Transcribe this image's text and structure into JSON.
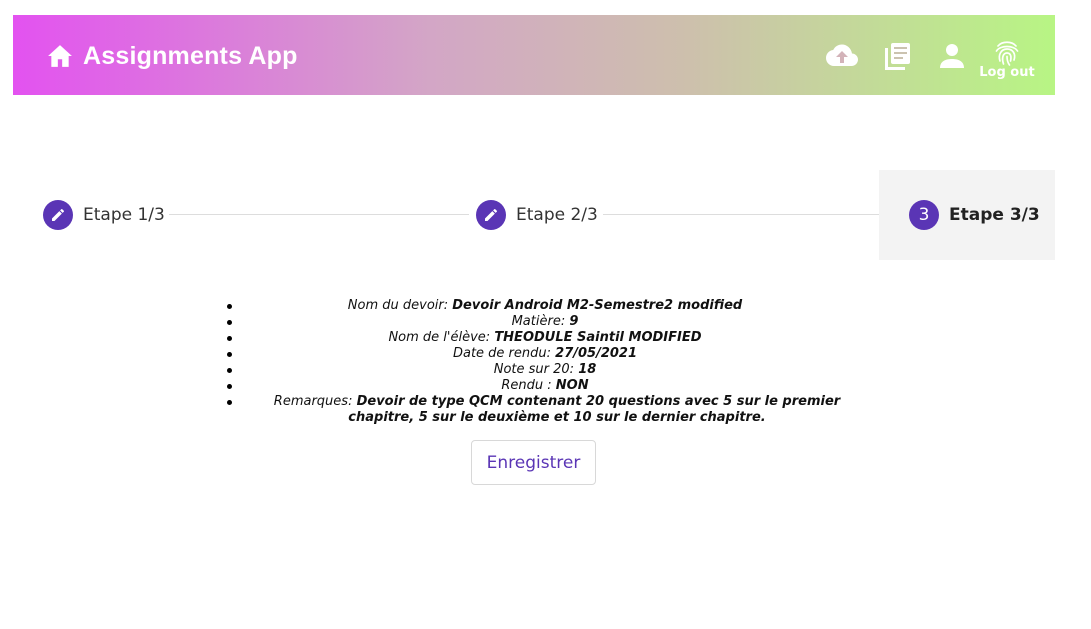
{
  "header": {
    "title": "Assignments App",
    "logout_label": "Log out",
    "icons": [
      "home-icon",
      "cloud-upload-icon",
      "library-books-icon",
      "person-icon",
      "fingerprint-icon"
    ],
    "gradient": [
      "#e352f0",
      "#b8f584"
    ]
  },
  "stepper": {
    "steps": [
      {
        "label": "Etape 1/3",
        "icon": "pencil-icon",
        "state": "done"
      },
      {
        "label": "Etape 2/3",
        "icon": "pencil-icon",
        "state": "done"
      },
      {
        "label": "Etape 3/3",
        "number": "3",
        "state": "active"
      }
    ],
    "accent": "#5a35b5"
  },
  "details": {
    "name_label": "Nom du devoir:",
    "name_value": "Devoir Android M2-Semestre2 modified",
    "subject_label": "Matière:",
    "subject_value": "9",
    "student_label": "Nom de l'élève:",
    "student_value": "THEODULE Saintil MODIFIED",
    "date_label": "Date de rendu:",
    "date_value": "27/05/2021",
    "grade_label": "Note sur 20:",
    "grade_value": "18",
    "returned_label": "Rendu :",
    "returned_value": "NON",
    "remarks_label": "Remarques:",
    "remarks_value": "Devoir de type QCM contenant 20 questions avec 5 sur le premier chapitre, 5 sur le deuxième et 10 sur le dernier chapitre."
  },
  "actions": {
    "save_label": "Enregistrer"
  }
}
